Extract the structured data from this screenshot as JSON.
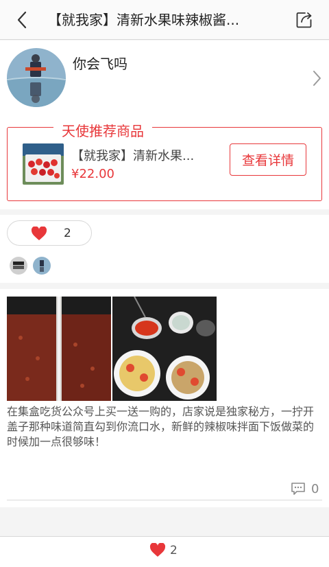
{
  "header": {
    "title": "【就我家】清新水果味辣椒酱...",
    "back_icon": "back-arrow-icon",
    "share_icon": "share-icon"
  },
  "user": {
    "name": "你会飞吗",
    "chevron_icon": "chevron-right-icon"
  },
  "recommendation": {
    "title": "天使推荐商品",
    "product_name": "【就我家】清新水果...",
    "price": "¥22.00",
    "detail_button": "查看详情"
  },
  "likes": {
    "count": "2",
    "icon": "heart-icon",
    "accent": "#e8373a"
  },
  "post": {
    "text": "在集盒吃货公众号上买一送一购的，店家说是独家秘方，一拧开盖子那种味道简直勾到你流口水，新鲜的辣椒味拌面下饭做菜的时候加一点很够味！",
    "comment_count": "0",
    "comment_icon": "comment-icon"
  },
  "footer": {
    "like_count": "2"
  }
}
